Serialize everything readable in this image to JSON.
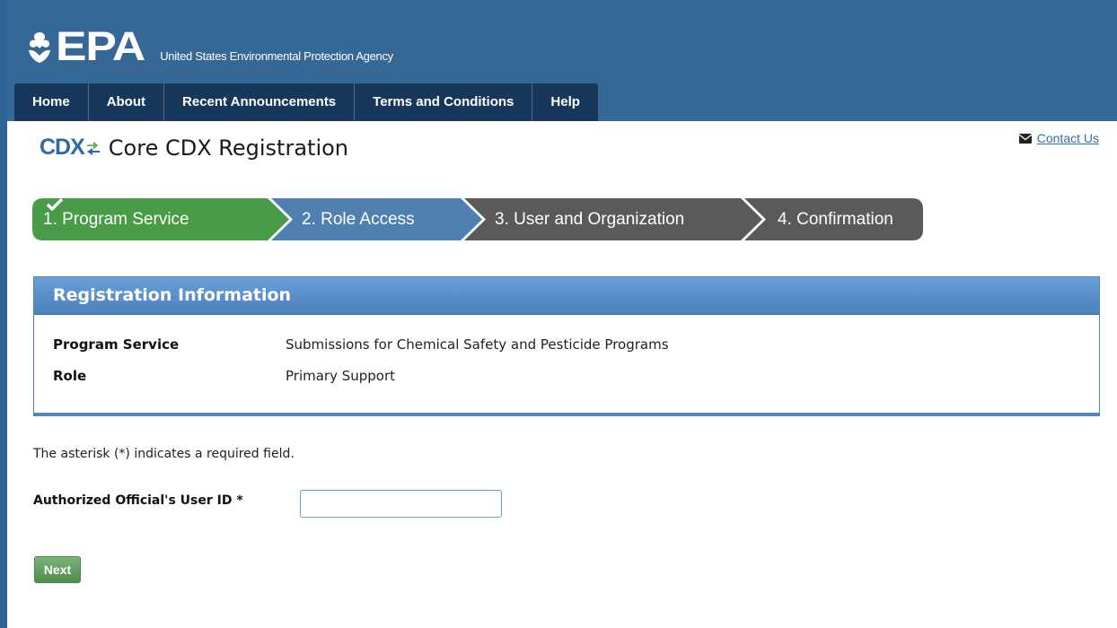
{
  "header": {
    "logo_text": "EPA",
    "agency_name": "United States Environmental Protection Agency",
    "nav": [
      "Home",
      "About",
      "Recent Announcements",
      "Terms and Conditions",
      "Help"
    ]
  },
  "title": {
    "logo": "CDX",
    "text": "Core CDX Registration"
  },
  "contact": {
    "label": "Contact Us",
    "icon": "envelope-icon"
  },
  "steps": [
    {
      "label": "1. Program Service",
      "status": "complete",
      "icon": "checkmark-icon",
      "color": "#4a9b47"
    },
    {
      "label": "2. Role Access",
      "status": "current",
      "color": "#4f80b0"
    },
    {
      "label": "3. User and Organization",
      "status": "pending",
      "color": "#5a5a5a"
    },
    {
      "label": "4. Confirmation",
      "status": "pending",
      "color": "#5a5a5a"
    }
  ],
  "registration": {
    "heading": "Registration Information",
    "rows": [
      {
        "label": "Program Service",
        "value": "Submissions for Chemical Safety and Pesticide Programs"
      },
      {
        "label": "Role",
        "value": "Primary Support"
      }
    ]
  },
  "form": {
    "required_note": "The asterisk (*) indicates a required field.",
    "user_id_label": "Authorized Official's User ID *",
    "user_id_value": "",
    "next_label": "Next"
  },
  "colors": {
    "header_bg": "#356797",
    "nav_bg": "#17385a",
    "accent_blue": "#4f85bb",
    "success_green": "#4a9b47",
    "link": "#2f6fb0"
  }
}
